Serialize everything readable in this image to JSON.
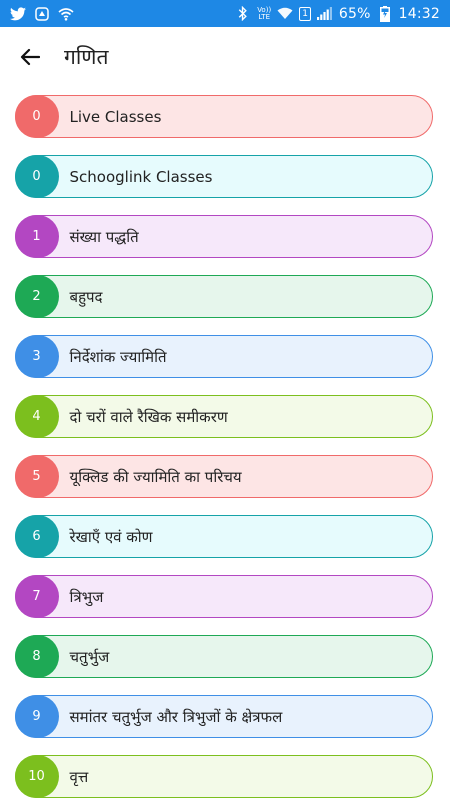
{
  "status_bar": {
    "left_icons": [
      "twitter-icon",
      "app-icon",
      "wifi-calling-icon"
    ],
    "volte_top": "Vo))",
    "volte_bottom": "LTE",
    "sim": "1",
    "battery_percent": "65%",
    "time": "14:32"
  },
  "header": {
    "back_icon": "arrow-left-icon",
    "title": "गणित"
  },
  "colors": {
    "statusbar": "#1e88e5"
  },
  "items": [
    {
      "number": "0",
      "label": "Live Classes",
      "accent": "#f06a6a",
      "bg": "#fde5e5"
    },
    {
      "number": "0",
      "label": "Schooglink Classes",
      "accent": "#16a3a8",
      "bg": "#e6fbfd"
    },
    {
      "number": "1",
      "label": "संख्या पद्धति",
      "accent": "#b347c2",
      "bg": "#f6e8fa"
    },
    {
      "number": "2",
      "label": "बहुपद",
      "accent": "#1ea955",
      "bg": "#e6f6ec"
    },
    {
      "number": "3",
      "label": "निर्देशांक ज्यामिति",
      "accent": "#3f8fe6",
      "bg": "#e8f2fd"
    },
    {
      "number": "4",
      "label": "दो चरों वाले रैखिक समीकरण",
      "accent": "#7cbf1e",
      "bg": "#f3fae8"
    },
    {
      "number": "5",
      "label": "यूक्लिड की ज्यामिति का परिचय",
      "accent": "#f06a6a",
      "bg": "#fde5e5"
    },
    {
      "number": "6",
      "label": "रेखाएँ एवं कोण",
      "accent": "#16a3a8",
      "bg": "#e6fbfd"
    },
    {
      "number": "7",
      "label": "त्रिभुज",
      "accent": "#b347c2",
      "bg": "#f6e8fa"
    },
    {
      "number": "8",
      "label": "चतुर्भुज",
      "accent": "#1ea955",
      "bg": "#e6f6ec"
    },
    {
      "number": "9",
      "label": "समांतर चतुर्भुज और त्रिभुजों के क्षेत्रफल",
      "accent": "#3f8fe6",
      "bg": "#e8f2fd"
    },
    {
      "number": "10",
      "label": "वृत्त",
      "accent": "#7cbf1e",
      "bg": "#f3fae8"
    }
  ]
}
